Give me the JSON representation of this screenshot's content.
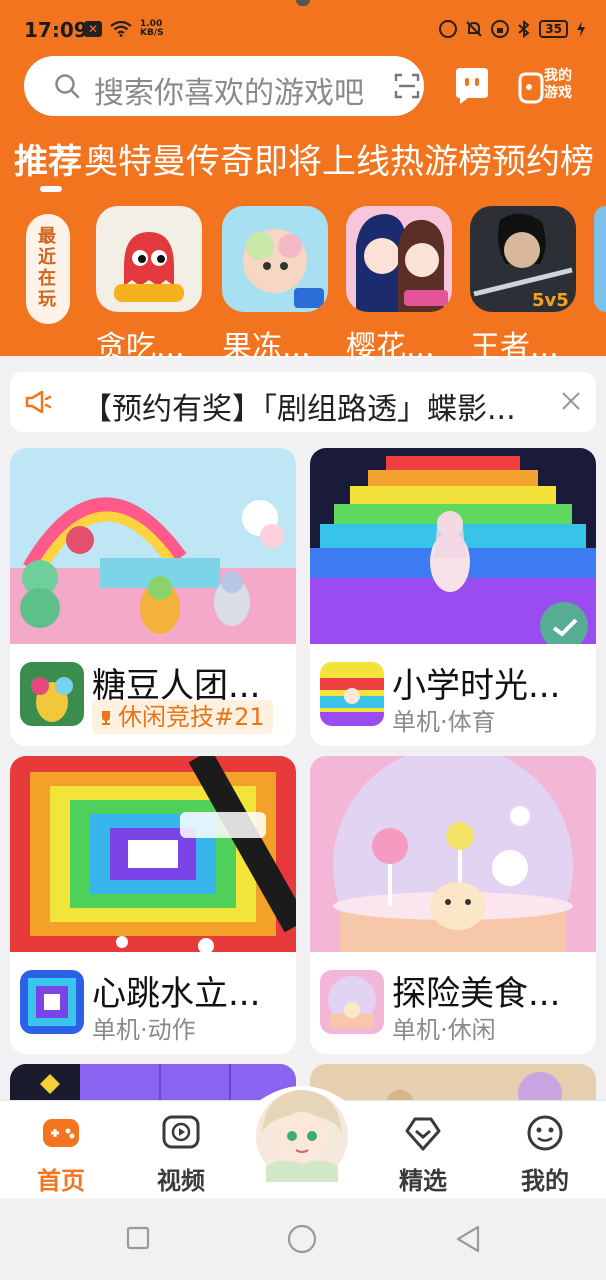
{
  "status_bar": {
    "time": "17:09",
    "net_speed_top": "1.00",
    "net_speed_bottom": "KB/S",
    "battery": "35"
  },
  "search": {
    "placeholder": "搜索你喜欢的游戏吧"
  },
  "header": {
    "my_games_line1": "我的",
    "my_games_line2": "游戏"
  },
  "tabs": {
    "items": [
      "推荐",
      "奥特曼传奇即将上线",
      "热游榜",
      "预约榜"
    ]
  },
  "recent": {
    "label": "最近在玩",
    "items": [
      {
        "name": "贪吃...",
        "icon": "pacman-ghost-icon"
      },
      {
        "name": "果冻...",
        "icon": "jelly-party-icon"
      },
      {
        "name": "樱花...",
        "icon": "sakura-school-icon"
      },
      {
        "name": "王者...",
        "icon": "kings-honor-icon"
      }
    ]
  },
  "notice": {
    "text": "【预约有奖】「剧组路透」蝶影..."
  },
  "cards": [
    {
      "title": "糖豆人团...",
      "badge": "休闲竞技#21"
    },
    {
      "title": "小学时光...",
      "subtitle": "单机·体育"
    },
    {
      "title": "心跳水立...",
      "subtitle": "单机·动作"
    },
    {
      "title": "探险美食...",
      "subtitle": "单机·休闲"
    }
  ],
  "bottom_nav": {
    "items": [
      {
        "label": "首页",
        "active": true
      },
      {
        "label": "视频",
        "active": false
      },
      {
        "label": "精选",
        "active": false
      },
      {
        "label": "我的",
        "active": false
      }
    ]
  },
  "colors": {
    "brand_orange": "#f2741f",
    "background": "#f1f1f3"
  }
}
